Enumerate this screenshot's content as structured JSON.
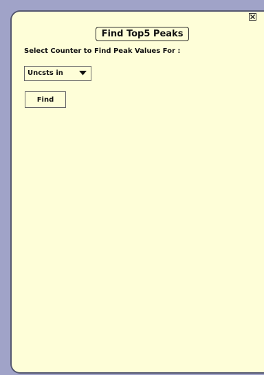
{
  "dialog": {
    "title": "Find Top5 Peaks",
    "prompt": "Select Counter to Find Peak Values For :",
    "counter_select": {
      "selected": "Uncsts in"
    },
    "find_label": "Find"
  },
  "icons": {
    "close": "close-icon",
    "dropdown": "chevron-down-icon"
  },
  "colors": {
    "panel_bg": "#fefed8",
    "outer_bg": "#a0a3c8",
    "border": "#55586f"
  }
}
